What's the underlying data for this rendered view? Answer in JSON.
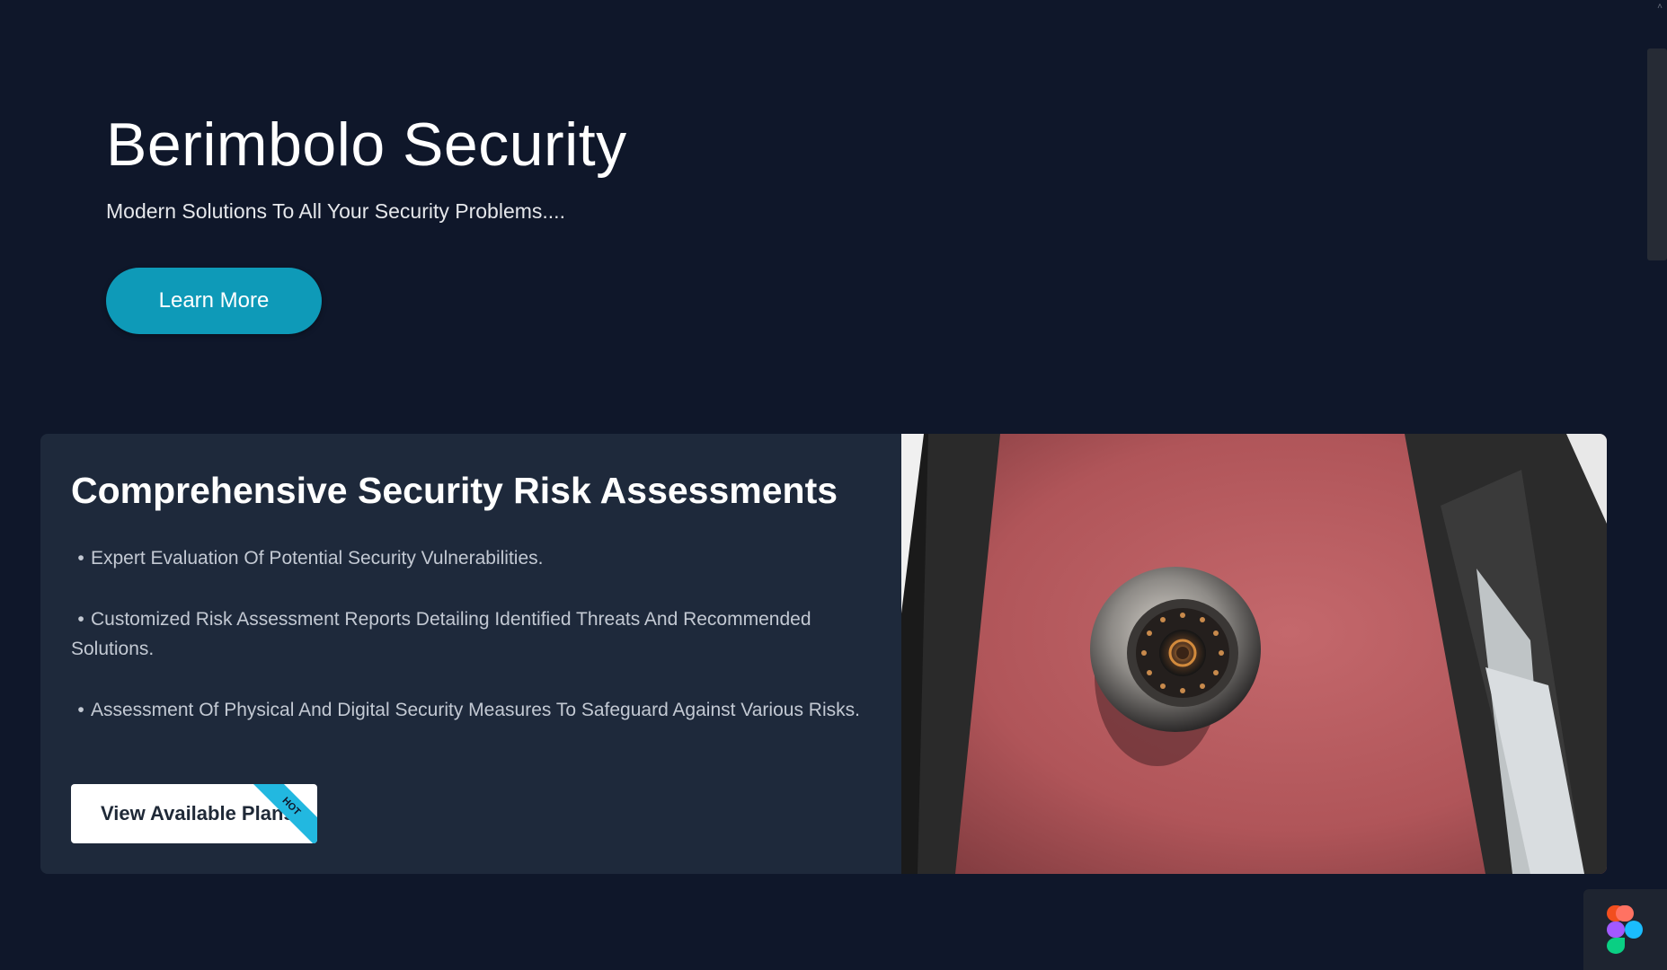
{
  "hero": {
    "title": "Berimbolo Security",
    "subtitle": "Modern Solutions To All Your Security Problems....",
    "cta_label": "Learn More"
  },
  "feature": {
    "title": "Comprehensive Security Risk Assessments",
    "bullets": [
      "Expert Evaluation Of Potential Security Vulnerabilities.",
      "Customized Risk Assessment Reports Detailing Identified Threats And Recommended Solutions.",
      "Assessment Of Physical And Digital Security Measures To Safeguard Against Various Risks."
    ],
    "bullet_symbol": "•",
    "plans_label": "View Available Plans",
    "ribbon_label": "HOT",
    "photo_icon": "security-camera-photo"
  },
  "colors": {
    "background": "#0f172a",
    "card": "#1e293b",
    "accent": "#0e9ab8",
    "ribbon": "#22b8e0"
  },
  "scrollbar": {
    "up_arrow": "˄"
  },
  "badge_icon": "figma-logo-icon"
}
